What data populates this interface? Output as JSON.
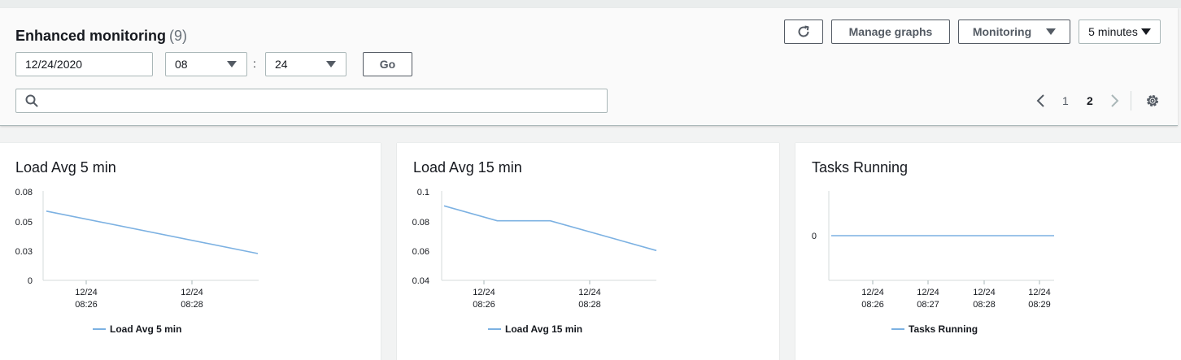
{
  "header": {
    "title": "Enhanced monitoring",
    "count": "(9)",
    "date_value": "12/24/2020",
    "hour_value": "08",
    "colon": ":",
    "minute_value": "24",
    "go_label": "Go",
    "search_placeholder": "",
    "refresh_icon": "refresh-icon",
    "manage_graphs_label": "Manage graphs",
    "monitoring_label": "Monitoring",
    "interval_label": "5 minutes"
  },
  "pagination": {
    "pages": [
      "1",
      "2"
    ],
    "current": "2"
  },
  "chart_data": [
    {
      "type": "line",
      "title": "Load Avg 5 min",
      "series": [
        {
          "name": "Load Avg 5 min",
          "x": [
            "12/24 08:25",
            "12/24 08:29"
          ],
          "values": [
            0.062,
            0.024
          ]
        }
      ],
      "y_ticks": [
        "0.08",
        "0.05",
        "0.03",
        "0"
      ],
      "x_ticks": [
        [
          "12/24",
          "08:26"
        ],
        [
          "12/24",
          "08:28"
        ]
      ],
      "ylim": [
        0,
        0.08
      ],
      "legend": "bottom",
      "color": "#7cb1e2"
    },
    {
      "type": "line",
      "title": "Load Avg 15 min",
      "series": [
        {
          "name": "Load Avg 15 min",
          "x": [
            "12/24 08:25",
            "12/24 08:26",
            "12/24 08:27",
            "12/24 08:29"
          ],
          "values": [
            0.09,
            0.08,
            0.08,
            0.06
          ]
        }
      ],
      "y_ticks": [
        "0.1",
        "0.08",
        "0.06",
        "0.04"
      ],
      "x_ticks": [
        [
          "12/24",
          "08:26"
        ],
        [
          "12/24",
          "08:28"
        ]
      ],
      "ylim": [
        0.04,
        0.1
      ],
      "legend": "bottom",
      "color": "#7cb1e2"
    },
    {
      "type": "line",
      "title": "Tasks Running",
      "series": [
        {
          "name": "Tasks Running",
          "x": [
            "12/24 08:25",
            "12/24 08:29"
          ],
          "values": [
            0,
            0
          ]
        }
      ],
      "y_ticks": [
        "0"
      ],
      "x_ticks": [
        [
          "12/24",
          "08:26"
        ],
        [
          "12/24",
          "08:27"
        ],
        [
          "12/24",
          "08:28"
        ],
        [
          "12/24",
          "08:29"
        ]
      ],
      "legend": "bottom",
      "color": "#7cb1e2"
    }
  ]
}
